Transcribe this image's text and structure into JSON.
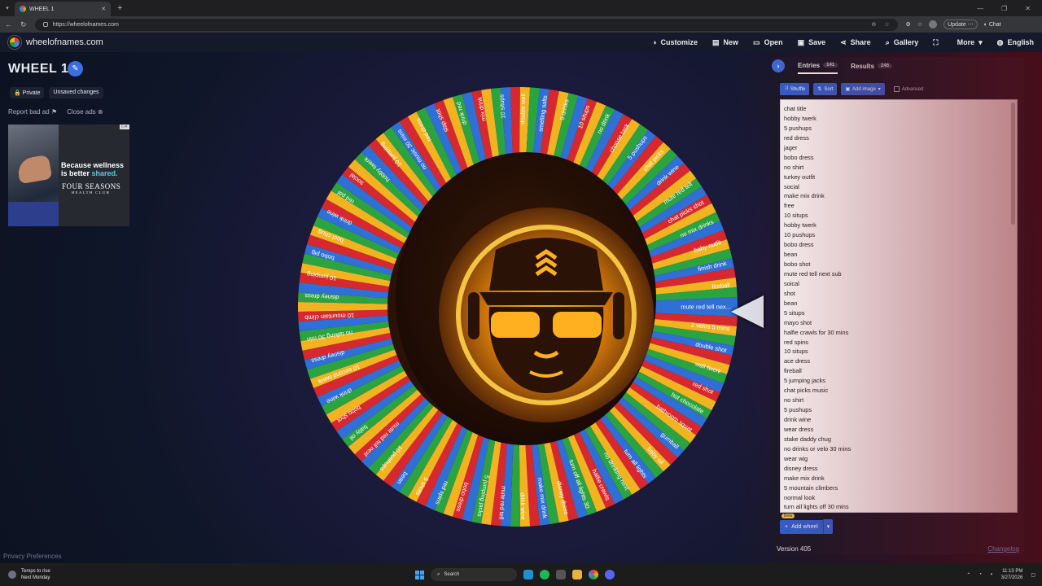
{
  "browser": {
    "tab_title": "WHEEL 1",
    "url": "https://wheelofnames.com",
    "update_label": "Update",
    "chat_label": "Chat"
  },
  "app": {
    "site_name": "wheelofnames.com",
    "menu": [
      {
        "label": "Customize",
        "icon": "palette-icon"
      },
      {
        "label": "New",
        "icon": "file-icon"
      },
      {
        "label": "Open",
        "icon": "folder-icon"
      },
      {
        "label": "Save",
        "icon": "save-icon"
      },
      {
        "label": "Share",
        "icon": "share-icon"
      },
      {
        "label": "Gallery",
        "icon": "search-icon"
      },
      {
        "label": "",
        "icon": "fullscreen-icon"
      },
      {
        "label": "More",
        "icon": "chevron-down-icon"
      },
      {
        "label": "English",
        "icon": "globe-icon"
      }
    ]
  },
  "wheel": {
    "title": "WHEEL 1",
    "private_label": "Private",
    "unsaved_label": "Unsaved changes",
    "segment_colors": [
      "#2f6fd6",
      "#d8282f",
      "#f2b321",
      "#2aa340"
    ],
    "labels": [
      "mute red tell nex...",
      "2 velos 5 mins",
      "double shot",
      "wall twerk",
      "red shot",
      "hot chocolate",
      "bathroom squat",
      "gumball",
      "baby oil",
      "turn all lights",
      "no drinking next",
      "halfie crawls",
      "turn off all lights 30",
      "disney dress",
      "make mix drink",
      "drink wine",
      "mute red tell",
      "5 jumping jacks",
      "bobo dress",
      "red spins",
      "5 shots",
      "bean",
      "10 pushups",
      "mute red tell next",
      "baby oil",
      "bobo shot",
      "drink wine",
      "10 second twerk",
      "disney dress",
      "no talking 30 min",
      "10 mountain climb",
      "disney dress",
      "10 jumping",
      "bobo pig",
      "boot chug",
      "drink wine",
      "red pal",
      "social",
      "hobby twerk",
      "10 jumping",
      "no music 30 mins",
      "red dress",
      "slap shot",
      "drink red",
      "mix drink",
      "10 situps",
      "double wall",
      "smelling salts",
      "5 drinks",
      "10 situps",
      "no drink",
      "choose task",
      "5 pushups",
      "chat picks",
      "drink wine",
      "mute red tell",
      "chat picks shot",
      "no mix drinks",
      "baby outfit",
      "finish drink",
      "fireball"
    ]
  },
  "ads": {
    "report_label": "Report bad ad",
    "close_label": "Close ads",
    "headline": "Because wellness",
    "headline2": "is better",
    "accent_word": "shared.",
    "brand": "FOUR SEASONS",
    "brand_sub": "HEALTH CLUB"
  },
  "panel": {
    "tab_entries": "Entries",
    "entries_count": "141",
    "tab_results": "Results",
    "results_count": "246",
    "shuffle_label": "Shuffle",
    "sort_label": "Sort",
    "add_image_label": "Add image",
    "advanced_label": "Advanced",
    "entries": [
      "chat title",
      "hobby twerk",
      "5 pushups",
      "red dress",
      "jager",
      "bobo dress",
      "no shirt",
      "turkey outfit",
      "social",
      "make mix drink",
      "free",
      "10 situps",
      "hobby twerk",
      "10 pushups",
      "bobo dress",
      "bean",
      "bobo shot",
      "mute red tell next sub",
      "soical",
      "shot",
      "bean",
      "5 situps",
      "mayo shot",
      "halfie crawls for 30 mins",
      "red spins",
      "10 situps",
      "ace dress",
      "fireball",
      "5 jumping jacks",
      "chat picks music",
      "no shirt",
      "5 pushups",
      "drink wine",
      "wear dress",
      "stake daddy chug",
      "no drinks or velo 30 mins",
      "wear wig",
      "disney dress",
      "make mix drink",
      "5 mountain climbers",
      "normal look",
      "turn all lights off 30 mins"
    ],
    "beta_label": "Beta",
    "add_wheel_label": "Add wheel",
    "version": "Version 405",
    "changelog": "Changelog"
  },
  "footer": {
    "privacy": "Privacy Preferences"
  },
  "taskbar": {
    "weather_line1": "Temps to rise",
    "weather_line2": "Next Monday",
    "search_placeholder": "Search",
    "time": "11:13 PM",
    "date": "3/27/2026"
  }
}
